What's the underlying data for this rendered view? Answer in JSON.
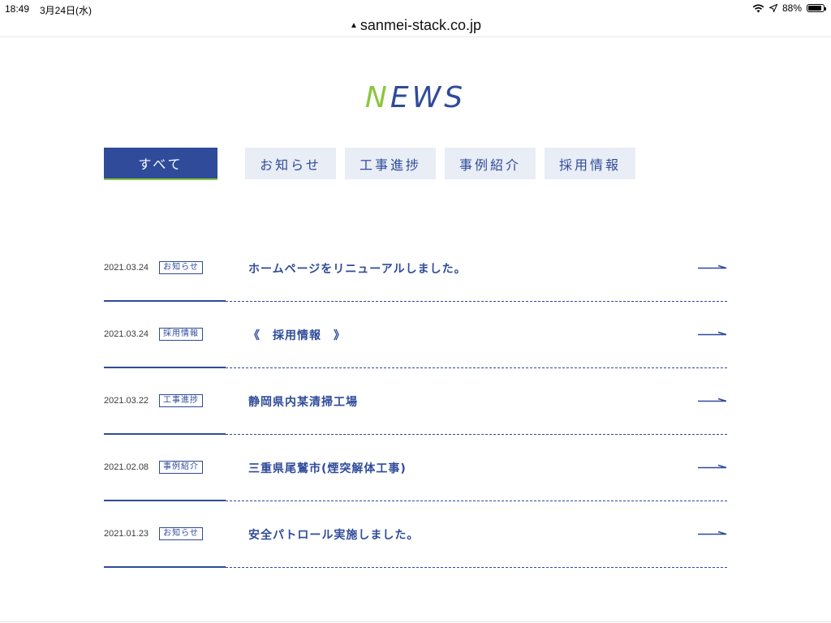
{
  "status_bar": {
    "time": "18:49",
    "date": "3月24日(水)",
    "battery": "88%",
    "battery_level": 0.88
  },
  "url_bar": {
    "url": "sanmei-stack.co.jp"
  },
  "page": {
    "title_first": "N",
    "title_rest": "EWS",
    "accent_green": "#8cc63f",
    "accent_blue": "#2f4b9a"
  },
  "tabs": [
    {
      "label": "すべて",
      "active": true
    },
    {
      "label": "お知らせ",
      "active": false
    },
    {
      "label": "工事進捗",
      "active": false
    },
    {
      "label": "事例紹介",
      "active": false
    },
    {
      "label": "採用情報",
      "active": false
    }
  ],
  "news": [
    {
      "date": "2021.03.24",
      "category": "お知らせ",
      "title": "ホームページをリニューアルしました。"
    },
    {
      "date": "2021.03.24",
      "category": "採用情報",
      "title": "《　採用情報　》"
    },
    {
      "date": "2021.03.22",
      "category": "工事進捗",
      "title": "静岡県内某清掃工場"
    },
    {
      "date": "2021.02.08",
      "category": "事例紹介",
      "title": "三重県尾鷲市(煙突解体工事)"
    },
    {
      "date": "2021.01.23",
      "category": "お知らせ",
      "title": "安全パトロール実施しました。"
    }
  ]
}
